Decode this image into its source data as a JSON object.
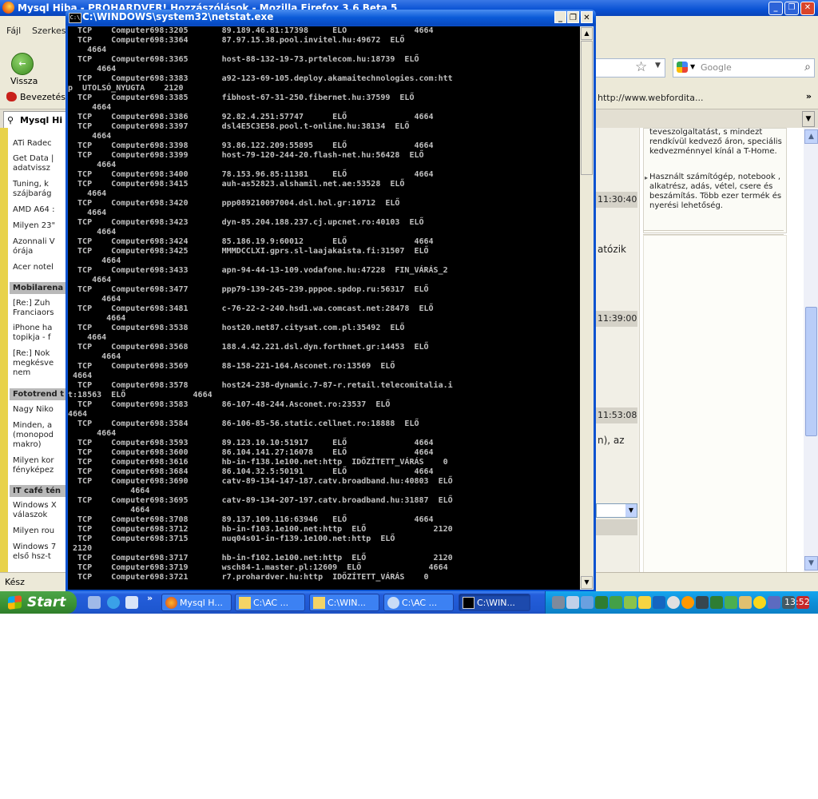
{
  "firefox": {
    "title": "Mysql Hiba - PROHARDVER! Hozzászólások - Mozilla Firefox 3.6 Beta 5",
    "menu": [
      "Fájl",
      "Szerkes"
    ],
    "back_label": "Vissza",
    "search_placeholder": "Google",
    "bookmarks": [
      "Bevezetés",
      "http://www.webfordita..."
    ],
    "tab_label": "Mysql Hi",
    "status_text": "Kész"
  },
  "left_sidebar": {
    "items_a": [
      "ATi Radec",
      "Get Data | adatvissz",
      "Tuning, k szájbarág",
      "AMD A64 :",
      "Milyen 23\"",
      "Azonnali V órája",
      "Acer notel"
    ],
    "section_1": "Mobilarena",
    "items_b": [
      "[Re:] Zuh Franciaors",
      "iPhone ha topikja - f",
      "[Re:] Nok megkésve nem"
    ],
    "section_2": "Fototrend t",
    "items_c": [
      "Nagy Niko",
      "Minden, a (monopod makro)",
      "Milyen kor fényképez"
    ],
    "section_3": "IT café tén",
    "items_d": [
      "Windows X válaszok",
      "Milyen rou",
      "Windows 7 első hsz-t"
    ]
  },
  "middle": {
    "times": [
      "11:30:40",
      "11:39:00",
      "11:53:08"
    ],
    "fragment_1": "atózik",
    "fragment_2": "n),  az"
  },
  "right_sidebar": {
    "para_1": "teveszolgaltatást, s mindezt rendkívül kedvező áron, speciális kedvezménnyel kínál a T-Home.",
    "para_2": "Használt számítógép, notebook , alkatrész, adás, vétel, csere és beszámítás. Több ezer termék és nyerési lehetőség."
  },
  "cmd": {
    "title": "C:\\WINDOWS\\system32\\netstat.exe",
    "output": [
      "  TCP    Computer698:3205       89.189.46.81:17398     ELŐ              4664",
      "  TCP    Computer698:3364       87.97.15.38.pool.invitel.hu:49672  ELŐ",
      "    4664",
      "  TCP    Computer698:3365       host-88-132-19-73.prtelecom.hu:18739  ELŐ",
      "      4664",
      "  TCP    Computer698:3383       a92-123-69-105.deploy.akamaitechnologies.com:htt",
      "p  UTOLSÓ_NYUGTA    2120",
      "  TCP    Computer698:3385       fibhost-67-31-250.fibernet.hu:37599  ELŐ",
      "     4664",
      "  TCP    Computer698:3386       92.82.4.251:57747      ELŐ              4664",
      "  TCP    Computer698:3397       dsl4E5C3E58.pool.t-online.hu:38134  ELŐ",
      "     4664",
      "  TCP    Computer698:3398       93.86.122.209:55895    ELŐ              4664",
      "  TCP    Computer698:3399       host-79-120-244-20.flash-net.hu:56428  ELŐ",
      "      4664",
      "  TCP    Computer698:3400       78.153.96.85:11381     ELŐ              4664",
      "  TCP    Computer698:3415       auh-as52823.alshamil.net.ae:53528  ELŐ",
      "    4664",
      "  TCP    Computer698:3420       ppp089210097004.dsl.hol.gr:10712  ELŐ",
      "    4664",
      "  TCP    Computer698:3423       dyn-85.204.188.237.cj.upcnet.ro:40103  ELŐ",
      "      4664",
      "  TCP    Computer698:3424       85.186.19.9:60012      ELŐ              4664",
      "  TCP    Computer698:3425       MMMDCCLXI.gprs.sl-laajakaista.fi:31507  ELŐ",
      "       4664",
      "  TCP    Computer698:3433       apn-94-44-13-109.vodafone.hu:47228  FIN_VÁRÁS_2",
      "     4664",
      "  TCP    Computer698:3477       ppp79-139-245-239.pppoe.spdop.ru:56317  ELŐ",
      "       4664",
      "  TCP    Computer698:3481       c-76-22-2-240.hsd1.wa.comcast.net:28478  ELŐ",
      "        4664",
      "  TCP    Computer698:3538       host20.net87.citysat.com.pl:35492  ELŐ",
      "    4664",
      "  TCP    Computer698:3568       188.4.42.221.dsl.dyn.forthnet.gr:14453  ELŐ",
      "       4664",
      "  TCP    Computer698:3569       88-158-221-164.Asconet.ro:13569  ELŐ",
      " 4664",
      "  TCP    Computer698:3578       host24-238-dynamic.7-87-r.retail.telecomitalia.i",
      "t:18563  ELŐ              4664",
      "  TCP    Computer698:3583       86-107-48-244.Asconet.ro:23537  ELŐ",
      "4664",
      "  TCP    Computer698:3584       86-106-85-56.static.cellnet.ro:18888  ELŐ",
      "      4664",
      "  TCP    Computer698:3593       89.123.10.10:51917     ELŐ              4664",
      "  TCP    Computer698:3600       86.104.141.27:16078    ELŐ              4664",
      "  TCP    Computer698:3616       hb-in-f138.1e100.net:http  IDŐZÍTETT_VÁRÁS    0",
      "  TCP    Computer698:3684       86.104.32.5:50191      ELŐ              4664",
      "  TCP    Computer698:3690       catv-89-134-147-187.catv.broadband.hu:40803  ELŐ",
      "             4664",
      "  TCP    Computer698:3695       catv-89-134-207-197.catv.broadband.hu:31887  ELŐ",
      "             4664",
      "  TCP    Computer698:3708       89.137.109.116:63946   ELŐ              4664",
      "  TCP    Computer698:3712       hb-in-f103.1e100.net:http  ELŐ              2120",
      "  TCP    Computer698:3715       nuq04s01-in-f139.1e100.net:http  ELŐ",
      " 2120",
      "  TCP    Computer698:3717       hb-in-f102.1e100.net:http  ELŐ              2120",
      "  TCP    Computer698:3719       wsch84-1.master.pl:12609  ELŐ              4664",
      "  TCP    Computer698:3721       r7.prohardver.hu:http  IDŐZÍTETT_VÁRÁS    0"
    ]
  },
  "taskbar": {
    "start_label": "Start",
    "tasks": [
      "Mysql H...",
      "C:\\AC ...",
      "C:\\WIN...",
      "C:\\AC ...",
      "C:\\WIN..."
    ],
    "clock": "13:52"
  }
}
